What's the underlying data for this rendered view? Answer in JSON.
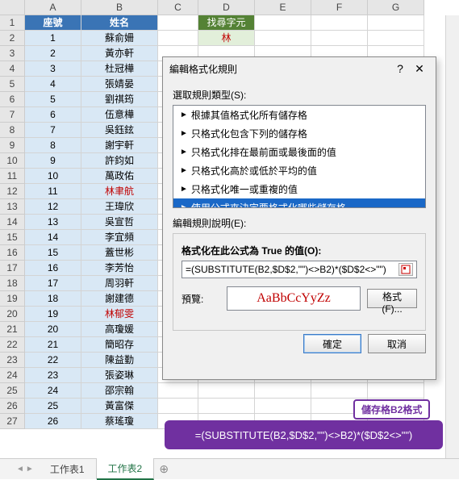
{
  "columns": [
    "A",
    "B",
    "C",
    "D",
    "E",
    "F",
    "G"
  ],
  "header_row": {
    "a": "座號",
    "b": "姓名"
  },
  "find": {
    "label": "找尋字元",
    "value": "林"
  },
  "rows": [
    {
      "n": 1,
      "name": "蘇俞姍",
      "red": false
    },
    {
      "n": 2,
      "name": "黃亦軒",
      "red": false
    },
    {
      "n": 3,
      "name": "杜冠樺",
      "red": false
    },
    {
      "n": 4,
      "name": "張婧晏",
      "red": false
    },
    {
      "n": 5,
      "name": "劉祺筠",
      "red": false
    },
    {
      "n": 6,
      "name": "伍意樺",
      "red": false
    },
    {
      "n": 7,
      "name": "吳鈺鉉",
      "red": false
    },
    {
      "n": 8,
      "name": "謝宇軒",
      "red": false
    },
    {
      "n": 9,
      "name": "許鈞如",
      "red": false
    },
    {
      "n": 10,
      "name": "萬政佑",
      "red": false
    },
    {
      "n": 11,
      "name": "林聿航",
      "red": true
    },
    {
      "n": 12,
      "name": "王瑋欣",
      "red": false
    },
    {
      "n": 13,
      "name": "吳宣哲",
      "red": false
    },
    {
      "n": 14,
      "name": "李宜頻",
      "red": false
    },
    {
      "n": 15,
      "name": "蓋世彬",
      "red": false
    },
    {
      "n": 16,
      "name": "李芳怡",
      "red": false
    },
    {
      "n": 17,
      "name": "周羽軒",
      "red": false
    },
    {
      "n": 18,
      "name": "謝建德",
      "red": false
    },
    {
      "n": 19,
      "name": "林郁雯",
      "red": true
    },
    {
      "n": 20,
      "name": "高瓊媛",
      "red": false
    },
    {
      "n": 21,
      "name": "簡昭存",
      "red": false
    },
    {
      "n": 22,
      "name": "陳益勤",
      "red": false
    },
    {
      "n": 23,
      "name": "張姿琳",
      "red": false
    },
    {
      "n": 24,
      "name": "邵宗翰",
      "red": false
    },
    {
      "n": 25,
      "name": "黃富傑",
      "red": false
    },
    {
      "n": 26,
      "name": "蔡瑤瓊",
      "red": false
    }
  ],
  "dialog": {
    "title": "編輯格式化規則",
    "section1": "選取規則類型(S):",
    "rules": [
      "根據其值格式化所有儲存格",
      "只格式化包含下列的儲存格",
      "只格式化排在最前面或最後面的值",
      "只格式化高於或低於平均的值",
      "只格式化唯一或重複的值",
      "使用公式來決定要格式化哪些儲存格"
    ],
    "section2": "編輯規則說明(E):",
    "formula_label": "格式化在此公式為 True 的值(O):",
    "formula": "=(SUBSTITUTE(B2,$D$2,\"\")<>B2)*($D$2<>\"\")",
    "preview_label": "預覽:",
    "preview_text": "AaBbCcYyZz",
    "format_btn": "格式(F)...",
    "ok": "確定",
    "cancel": "取消"
  },
  "callout": {
    "label": "儲存格B2格式",
    "formula": "=(SUBSTITUTE(B2,$D$2,\"\")<>B2)*($D$2<>\"\")"
  },
  "tabs": {
    "t1": "工作表1",
    "t2": "工作表2"
  }
}
